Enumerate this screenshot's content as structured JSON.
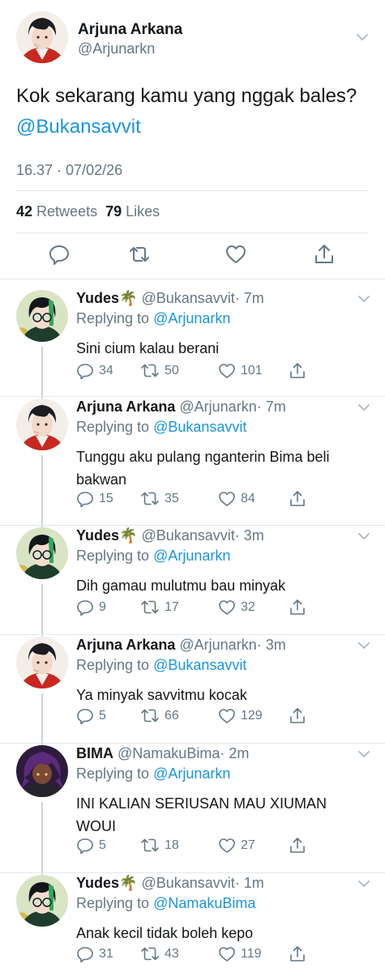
{
  "main_tweet": {
    "name": "Arjuna Arkana",
    "handle": "@Arjunarkn",
    "text": "Kok sekarang kamu yang nggak bales?",
    "mention": "@Bukansavvit",
    "timestamp": "16.37 · 07/02/26",
    "retweets_count": "42",
    "retweets_label": "Retweets",
    "likes_count": "79",
    "likes_label": "Likes"
  },
  "replies": [
    {
      "name": "Yudes🌴",
      "handle": "@Bukansavvit",
      "time": "· 7m",
      "replying_prefix": "Replying to",
      "replying_to": "@Arjunarkn",
      "text": "Sini cium kalau berani",
      "replies": "34",
      "retweets": "50",
      "likes": "101"
    },
    {
      "name": "Arjuna Arkana",
      "handle": "@Arjunarkn",
      "time": "· 7m",
      "replying_prefix": "Replying to",
      "replying_to": "@Bukansavvit",
      "text": "Tunggu aku pulang nganterin Bima beli bakwan",
      "replies": "15",
      "retweets": "35",
      "likes": "84"
    },
    {
      "name": "Yudes🌴",
      "handle": "@Bukansavvit",
      "time": "· 3m",
      "replying_prefix": "Replying to",
      "replying_to": "@Arjunarkn",
      "text": "Dih gamau mulutmu bau minyak",
      "replies": "9",
      "retweets": "17",
      "likes": "32"
    },
    {
      "name": "Arjuna Arkana",
      "handle": "@Arjunarkn",
      "time": "· 3m",
      "replying_prefix": "Replying to",
      "replying_to": "@Bukansavvit",
      "text": "Ya minyak savvitmu kocak",
      "replies": "5",
      "retweets": "66",
      "likes": "129"
    },
    {
      "name": "BIMA",
      "handle": "@NamakuBima",
      "time": "· 2m",
      "replying_prefix": "Replying to",
      "replying_to": "@Arjunarkn",
      "text": "INI KALIAN SERIUSAN MAU XIUMAN WOUI",
      "replies": "5",
      "retweets": "18",
      "likes": "27"
    },
    {
      "name": "Yudes🌴",
      "handle": "@Bukansavvit",
      "time": "· 1m",
      "replying_prefix": "Replying to",
      "replying_to": "@NamakuBima",
      "text": "Anak kecil tidak boleh kepo",
      "replies": "31",
      "retweets": "43",
      "likes": "119"
    }
  ],
  "colors": {
    "accent": "#1b95e0",
    "muted": "#657786",
    "text": "#14171a",
    "divider": "#e1e8ed",
    "thread_line": "#ccd6dd"
  },
  "icons": [
    "reply-icon",
    "retweet-icon",
    "like-icon",
    "share-icon",
    "chevron-down-icon"
  ]
}
